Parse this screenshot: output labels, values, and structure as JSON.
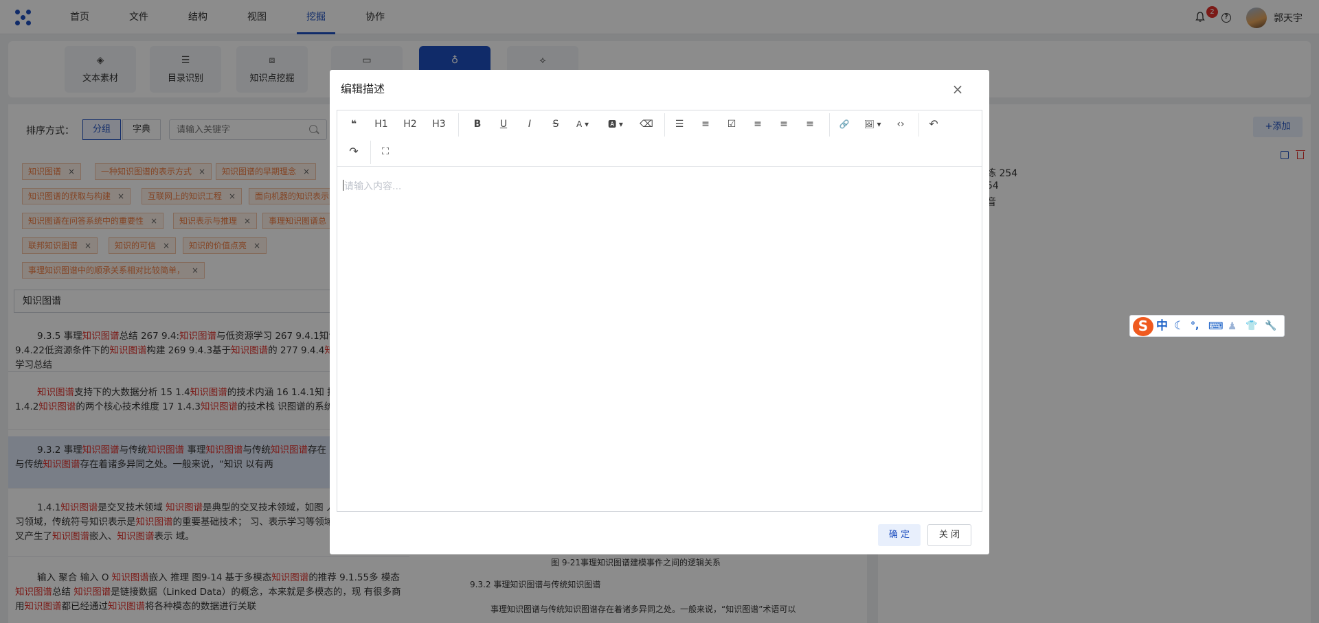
{
  "nav": {
    "tabs": [
      "首页",
      "文件",
      "结构",
      "视图",
      "挖掘",
      "协作"
    ],
    "active_tab": "挖掘",
    "notification_count": "2",
    "help_symbol": "?",
    "user_name": "郭天宇"
  },
  "subtools": [
    {
      "label": "文本素材",
      "icon": "layers-icon"
    },
    {
      "label": "目录识别",
      "icon": "list-icon"
    },
    {
      "label": "知识点挖掘",
      "icon": "frame-icon"
    },
    {
      "label": "",
      "icon": "window-icon"
    },
    {
      "label": "",
      "icon": "bulb-icon"
    },
    {
      "label": "",
      "icon": "graph-icon"
    }
  ],
  "left": {
    "sort_label": "排序方式：",
    "sort_group": "分组",
    "sort_dict": "字典",
    "keyword_placeholder": "请输入关键字",
    "tags": [
      "知识图谱",
      "一种知识图谱的表示方式",
      "知识图谱的早期理念",
      "知识图谱的获取与构建",
      "互联网上的知识工程",
      "面向机器的知识表示",
      "知识图谱在问答系统中的重要性",
      "知识表示与推理",
      "事理知识图谱总",
      "联邦知识图谱",
      "知识的可信",
      "知识的价值点亮",
      "事理知识图谱中的顺承关系相对比较简单，"
    ],
    "query": "知识图谱",
    "results": [
      "9.3.5 事理知识图谱总结 267 9.4:知识图谱与低资源学习 267 9.4.1知识 源学习 267 9.4.22低资源条件下的知识图谱构建 269 9.4.3基于知识图谱的 277 9.4.4知识图谱与低资源学习总结",
      "知识图谱支持下的大数据分析 15 1.4知识图谱的技术内涵 16 1.4.1知 技术领域 16 1.4.2知识图谱的两个核心技术维度 17 1.4.3知识图谱的技术栈 识图谱的系统工程观 20",
      "9.3.2 事理知识图谱与传统知识图谱 事理知识图谱与传统知识图谱存在 处。事理知识图谱与传统知识图谱存在着诸多异同之处。一般来说，“知识 以有两",
      "1.4.1知识图谱是交叉技术领域 知识图谱是典型的交叉技术领域，如图 人工智能和机器学习领域，传统符号知识表示是知识图谱的重要基础技术； 习、表示学习等领域与知识图谱的交叉产生了知识图谱嵌入、知识图谱表示 域。",
      "输入 聚合 输入 O 知识图谱嵌入 推理 图9-14 基于多模态知识图谱的推荐 9.1.55多 模态知识图谱总结 知识图谱是链接数据（Linked Data）的概念，本来就是多模态的，现 有很多商用知识图谱都已经通过知识图谱将各种模态的数据进行关联"
    ]
  },
  "middle": {
    "figure_caption": "图 9-21事理知识图谱建模事件之间的逻辑关系",
    "section_heading": "9.3.2 事理知识图谱与传统知识图谱",
    "paragraph": "事理知识图谱与传统知识图谱存在着诸多异同之处。一般来说，“知识图谱”术语可以"
  },
  "right": {
    "add_label": "+添加",
    "lines": [
      "练 254",
      "54",
      "音"
    ]
  },
  "modal": {
    "title": "编辑描述",
    "close_symbol": "×",
    "toolbar_row1": [
      {
        "name": "quote-icon",
        "text": "❝"
      },
      {
        "name": "h1-button",
        "text": "H1"
      },
      {
        "name": "h2-button",
        "text": "H2"
      },
      {
        "name": "h3-button",
        "text": "H3"
      },
      {
        "name": "bold-icon",
        "text": "B"
      },
      {
        "name": "underline-icon",
        "text": "U"
      },
      {
        "name": "italic-icon",
        "text": "I"
      },
      {
        "name": "strikethrough-icon",
        "text": "S"
      },
      {
        "name": "font-color-icon",
        "text": "A ▾"
      },
      {
        "name": "bg-color-icon",
        "text": "🅰 ▾"
      },
      {
        "name": "clear-format-icon",
        "text": "⌫"
      },
      {
        "name": "bullet-list-icon",
        "text": "☰"
      },
      {
        "name": "ordered-list-icon",
        "text": "≡"
      },
      {
        "name": "todo-icon",
        "text": "☑"
      },
      {
        "name": "align-left-icon",
        "text": "≡"
      },
      {
        "name": "align-right-icon",
        "text": "≡"
      },
      {
        "name": "align-justify-icon",
        "text": "≡"
      },
      {
        "name": "link-icon",
        "text": "🔗"
      },
      {
        "name": "image-icon",
        "text": "🖼 ▾"
      },
      {
        "name": "code-icon",
        "text": "‹›"
      },
      {
        "name": "undo-icon",
        "text": "↶"
      }
    ],
    "toolbar_row2": [
      {
        "name": "redo-icon",
        "text": "↷"
      },
      {
        "name": "fullscreen-icon",
        "text": "⛶"
      }
    ],
    "editor_placeholder": "请输入内容...",
    "ok_label": "确 定",
    "close_label": "关 闭"
  },
  "ime": {
    "logo": "S",
    "lang": "中",
    "items": [
      "☾",
      "°,",
      "⌨",
      "♟",
      "👕",
      "🔧"
    ]
  }
}
